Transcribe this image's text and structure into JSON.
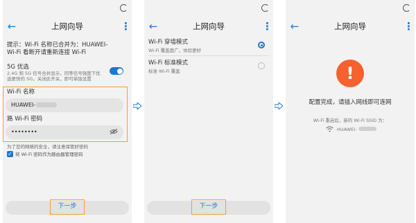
{
  "colors": {
    "accent": "#1f77d0",
    "highlight": "#f0a030",
    "warning": "#f5622e"
  },
  "screen1": {
    "title": "上网向导",
    "hint_line1": "提示：Wi-Fi 名称已合并为：HUAWEI-",
    "hint_line2": "Wi-Fi 看断开请重新连接 Wi-Fi",
    "priority_label": "5G 优选",
    "priority_desc1": "2.4G 和 5G 信号合并显示，同等信号强度下优",
    "priority_desc2": "选更快的 5G，关闭此开关，即可单独设置",
    "wifi_name_label": "Wi-Fi 名称",
    "wifi_name_value": "HUAWEI-",
    "wifi_pwd_label": "路 Wi-Fi 密码",
    "wifi_pwd_value": "••••••••",
    "security_note": "为了您的网络的安全，请注意保管好密码",
    "checkbox_label": "将 Wi-Fi 密码作为路由器管理密码",
    "next_label": "下一步"
  },
  "screen2": {
    "title": "上网向导",
    "mode1_title": "Wi-Fi 穿墙模式",
    "mode1_desc": "Wi-Fi 覆盖面广，体验更好",
    "mode2_title": "Wi-Fi 标准模式",
    "mode2_desc": "标准 Wi-Fi 覆盖",
    "next_label": "下一步"
  },
  "screen3": {
    "title": "上网向导",
    "done_text": "配置完成，请插入网线即可连网",
    "restart_text": "Wi-Fi 重启后，新的 Wi-Fi SSID 为：",
    "ssid_value": "HUAWEI-"
  }
}
